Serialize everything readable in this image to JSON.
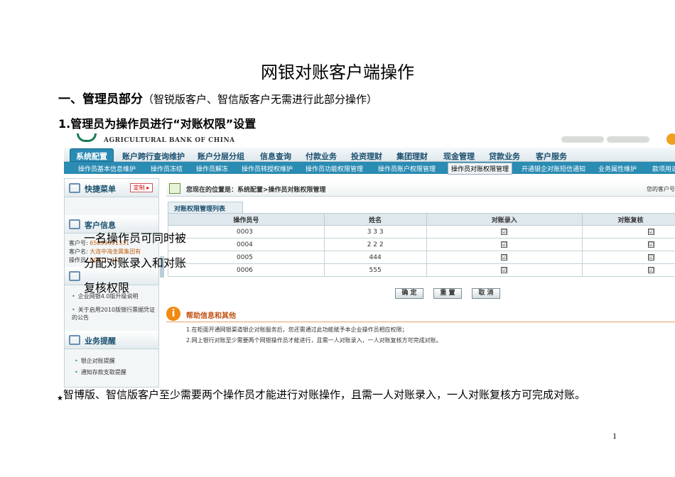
{
  "doc": {
    "title": "网银对账客户端操作",
    "heading1": "一、管理员部分",
    "heading1_note": "（智锐版客户、智信版客户无需进行此部分操作）",
    "heading2": "1.管理员为操作员进行“对账权限”设置",
    "overlay_lines": [
      "一名操作员可同时被",
      "分配对账录入和对账",
      "复核权限"
    ],
    "footnote_star": "★",
    "footnote": "智博版、智信版客户至少需要两个操作员才能进行对账操作，且需一人对账录入，一人对账复核方可完成对账。",
    "page_number": "1"
  },
  "screenshot": {
    "bank_name": "AGRICULTURAL BANK OF CHINA",
    "main_nav": [
      "系统配置",
      "账户跨行查询维护",
      "账户分层分组",
      "信息查询",
      "付款业务",
      "投资理财",
      "集团理财",
      "现金管理",
      "贷款业务",
      "客户服务"
    ],
    "sub_nav": [
      "操作员基本信息维护",
      "操作员冻结",
      "操作员解冻",
      "操作员转授权维护",
      "操作员功能权限管理",
      "操作员账户权限管理",
      "操作员对账权限管理",
      "开通银企对账短信通知",
      "业务属性维护",
      "款项用途"
    ],
    "left_panel": {
      "quick_menu": "快捷菜单",
      "customize": "定制",
      "customer_info": "客户信息",
      "customer_no_label": "客户号:",
      "customer_no": "65099981331",
      "customer_name_label": "客户名:",
      "customer_name": "大连中海金属集团有",
      "operator_label": "操作员:",
      "operator": "0001 1 1 1",
      "notice_items": [
        "企业网银4.0版升级说明",
        "关于启用2010版银行票据凭证的公告"
      ],
      "business_reminder": "业务提醒",
      "reminder_items": [
        "银企对账提醒",
        "通知存款支取提醒"
      ]
    },
    "breadcrumb": "您现在的位置是：系统配置>操作员对账权限管理",
    "breadcrumb_right": "您的客户号",
    "list_tab": "对账权限管理列表",
    "table": {
      "headers": [
        "操作员号",
        "姓名",
        "对账录入",
        "对账复核"
      ],
      "rows": [
        {
          "id": "0003",
          "name": "3 3 3",
          "entry": "☑",
          "review": "☑"
        },
        {
          "id": "0004",
          "name": "2 2 2",
          "entry": "☑",
          "review": "☑"
        },
        {
          "id": "0005",
          "name": "444",
          "entry": "☑",
          "review": "☑"
        },
        {
          "id": "0006",
          "name": "555",
          "entry": "☑",
          "review": "☑"
        }
      ]
    },
    "buttons": {
      "confirm": "确 定",
      "reset": "重 置",
      "cancel": "取 消"
    },
    "help": {
      "title": "帮助信息和其他",
      "lines": [
        "1.在柜面开通网银渠道银企对账服务后，您还需通过此功能赋予本企业操作员相应权限；",
        "2.网上银行对账至少需要两个网银操作员才能进行，且需一人对账录入，一人对账复核方可完成对账。"
      ]
    }
  }
}
